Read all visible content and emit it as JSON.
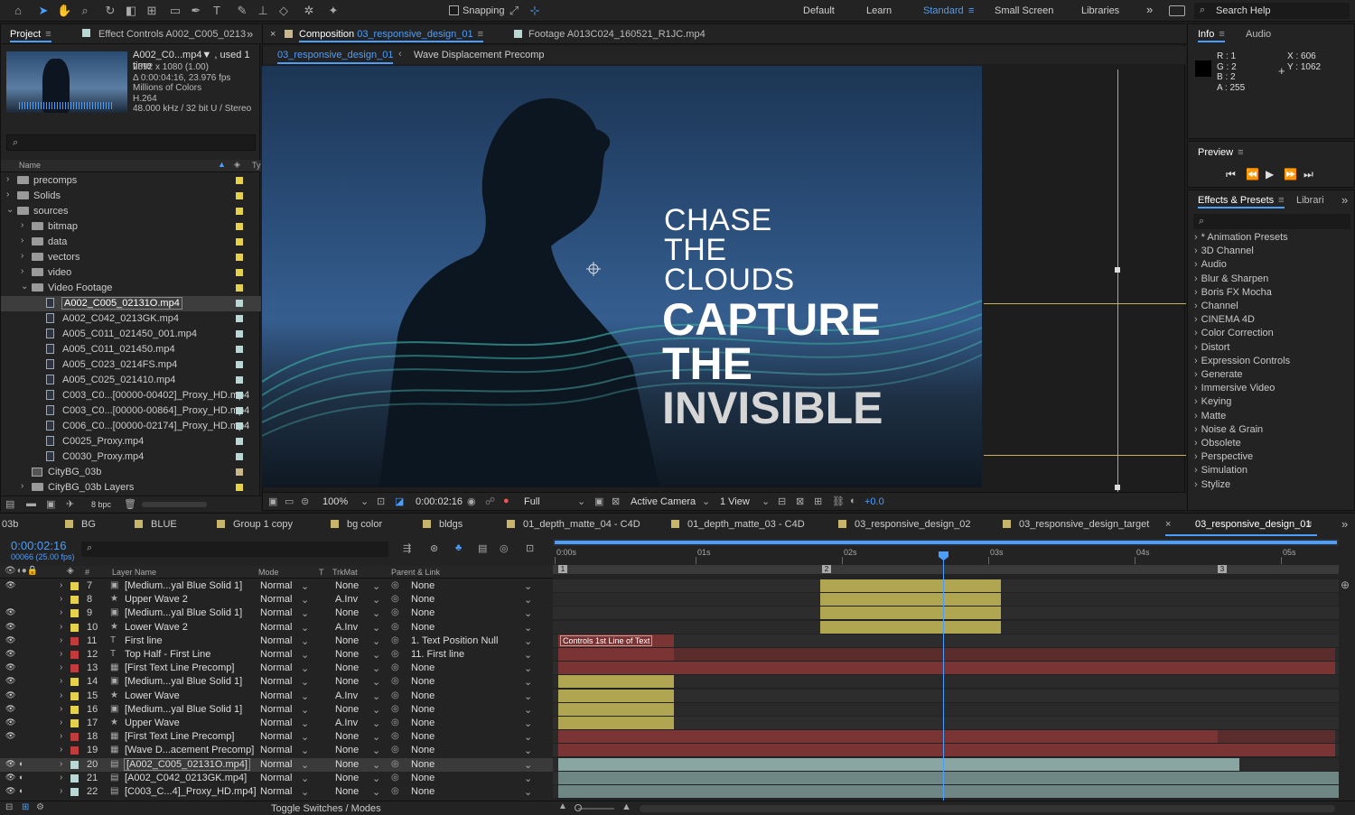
{
  "toolbar": {
    "snapping_label": "Snapping",
    "workspaces": [
      "Default",
      "Learn",
      "Standard",
      "Small Screen",
      "Libraries"
    ],
    "active_workspace": "Standard",
    "search_help": "Search Help"
  },
  "project_panel": {
    "tab_project": "Project",
    "tab_effect_controls": "Effect Controls A002_C005_0213",
    "selected_name": "A002_C0...mp4▼ , used 1 time",
    "info_lines": [
      "2592 x 1080 (1.00)",
      "Δ 0:00:04:16, 23.976 fps",
      "Millions of Colors",
      "H.264",
      "48.000 kHz / 32 bit U / Stereo"
    ],
    "col_name": "Name",
    "col_type": "Ty",
    "bpc": "8 bpc",
    "tree": [
      {
        "label": "precomps",
        "level": 0,
        "kind": "folder",
        "arrow": "›",
        "color": "#e6d24a"
      },
      {
        "label": "Solids",
        "level": 0,
        "kind": "folder",
        "arrow": "›",
        "color": "#e6d24a"
      },
      {
        "label": "sources",
        "level": 0,
        "kind": "folder",
        "arrow": "⌄",
        "color": "#e6d24a"
      },
      {
        "label": "bitmap",
        "level": 1,
        "kind": "folder",
        "arrow": "›",
        "color": "#e6d24a"
      },
      {
        "label": "data",
        "level": 1,
        "kind": "folder",
        "arrow": "›",
        "color": "#e6d24a"
      },
      {
        "label": "vectors",
        "level": 1,
        "kind": "folder",
        "arrow": "›",
        "color": "#e6d24a"
      },
      {
        "label": "video",
        "level": 1,
        "kind": "folder",
        "arrow": "›",
        "color": "#e6d24a"
      },
      {
        "label": "Video Footage",
        "level": 1,
        "kind": "folder",
        "arrow": "⌄",
        "color": "#e6d24a"
      },
      {
        "label": "A002_C005_02131O.mp4",
        "level": 2,
        "kind": "file",
        "arrow": "",
        "color": "#b9d8d5",
        "selected": true
      },
      {
        "label": "A002_C042_0213GK.mp4",
        "level": 2,
        "kind": "file",
        "arrow": "",
        "color": "#b9d8d5"
      },
      {
        "label": "A005_C011_021450_001.mp4",
        "level": 2,
        "kind": "file",
        "arrow": "",
        "color": "#b9d8d5"
      },
      {
        "label": "A005_C011_021450.mp4",
        "level": 2,
        "kind": "file",
        "arrow": "",
        "color": "#b9d8d5"
      },
      {
        "label": "A005_C023_0214FS.mp4",
        "level": 2,
        "kind": "file",
        "arrow": "",
        "color": "#b9d8d5"
      },
      {
        "label": "A005_C025_021410.mp4",
        "level": 2,
        "kind": "file",
        "arrow": "",
        "color": "#b9d8d5"
      },
      {
        "label": "C003_C0...[00000-00402]_Proxy_HD.mp4",
        "level": 2,
        "kind": "file",
        "arrow": "",
        "color": "#b9d8d5"
      },
      {
        "label": "C003_C0...[00000-00864]_Proxy_HD.mp4",
        "level": 2,
        "kind": "file",
        "arrow": "",
        "color": "#b9d8d5"
      },
      {
        "label": "C006_C0...[00000-02174]_Proxy_HD.mp4",
        "level": 2,
        "kind": "file",
        "arrow": "",
        "color": "#b9d8d5"
      },
      {
        "label": "C0025_Proxy.mp4",
        "level": 2,
        "kind": "file",
        "arrow": "",
        "color": "#b9d8d5"
      },
      {
        "label": "C0030_Proxy.mp4",
        "level": 2,
        "kind": "file",
        "arrow": "",
        "color": "#b9d8d5"
      },
      {
        "label": "CityBG_03b",
        "level": 1,
        "kind": "comp",
        "arrow": "",
        "color": "#c8b88a"
      },
      {
        "label": "CityBG_03b Layers",
        "level": 1,
        "kind": "folder",
        "arrow": "›",
        "color": "#e6d24a"
      }
    ]
  },
  "comp_panel": {
    "tab_comp_prefix": "Composition",
    "tab_comp_name": "03_responsive_design_01",
    "tab_footage": "Footage A013C024_160521_R1JC.mp4",
    "breadcrumb_current": "03_responsive_design_01",
    "breadcrumb_next": "Wave Displacement Precomp",
    "overlay_text": {
      "light": [
        "CHASE",
        "THE",
        "CLOUDS"
      ],
      "bold": [
        "CAPTURE",
        "THE",
        "INVISIBLE"
      ]
    },
    "footer": {
      "zoom": "100%",
      "timecode": "0:00:02:16",
      "resolution": "Full",
      "camera": "Active Camera",
      "view": "1 View",
      "exposure": "+0.0"
    }
  },
  "info_panel": {
    "tab_info": "Info",
    "tab_audio": "Audio",
    "r": "R : 1",
    "g": "G : 2",
    "b": "B : 2",
    "a": "A :  255",
    "x": "X : 606",
    "y": "Y : 1062"
  },
  "preview_panel": {
    "tab": "Preview"
  },
  "effects_panel": {
    "tab": "Effects & Presets",
    "tab2": "Librari",
    "items": [
      "* Animation Presets",
      "3D Channel",
      "Audio",
      "Blur & Sharpen",
      "Boris FX Mocha",
      "Channel",
      "CINEMA 4D",
      "Color Correction",
      "Distort",
      "Expression Controls",
      "Generate",
      "Immersive Video",
      "Keying",
      "Matte",
      "Noise & Grain",
      "Obsolete",
      "Perspective",
      "Simulation",
      "Stylize"
    ]
  },
  "timeline": {
    "tabs": [
      "03b",
      "BG",
      "BLUE",
      "Group 1 copy",
      "bg color",
      "bldgs",
      "01_depth_matte_04 - C4D",
      "01_depth_matte_03 - C4D",
      "03_responsive_design_02",
      "03_responsive_design_target",
      "03_responsive_design_01"
    ],
    "timecode": "0:00:02:16",
    "frame_info": "00066 (25.00 fps)",
    "headers": {
      "layer_name": "Layer Name",
      "mode": "Mode",
      "t": "T",
      "trkmat": "TrkMat",
      "parent": "Parent & Link"
    },
    "ruler": [
      "0:00s",
      "01s",
      "02s",
      "03s",
      "04s",
      "05s"
    ],
    "markers": [
      "1",
      "2",
      "3"
    ],
    "bar_label": "Controls 1st Line of Text",
    "toggle_label": "Toggle Switches / Modes",
    "layers": [
      {
        "num": "7",
        "name": "[Medium...yal Blue Solid 1]",
        "mode": "Normal",
        "trk": "None",
        "parent": "None",
        "color": "#e6d24a",
        "icon": "solid"
      },
      {
        "num": "8",
        "name": "Upper Wave 2",
        "mode": "Normal",
        "trk": "A.Inv",
        "parent": "None",
        "color": "#e6d24a",
        "icon": "shape"
      },
      {
        "num": "9",
        "name": "[Medium...yal Blue Solid 1]",
        "mode": "Normal",
        "trk": "None",
        "parent": "None",
        "color": "#e6d24a",
        "icon": "solid"
      },
      {
        "num": "10",
        "name": "Lower Wave 2",
        "mode": "Normal",
        "trk": "A.Inv",
        "parent": "None",
        "color": "#e6d24a",
        "icon": "shape"
      },
      {
        "num": "11",
        "name": "First line",
        "mode": "Normal",
        "trk": "None",
        "parent": "1. Text Position Null",
        "color": "#c23a3a",
        "icon": "text"
      },
      {
        "num": "12",
        "name": "Top Half - First Line",
        "mode": "Normal",
        "trk": "None",
        "parent": "11. First line",
        "color": "#c23a3a",
        "icon": "text"
      },
      {
        "num": "13",
        "name": "[First Text Line Precomp]",
        "mode": "Normal",
        "trk": "None",
        "parent": "None",
        "color": "#c23a3a",
        "icon": "comp"
      },
      {
        "num": "14",
        "name": "[Medium...yal Blue Solid 1]",
        "mode": "Normal",
        "trk": "None",
        "parent": "None",
        "color": "#e6d24a",
        "icon": "solid"
      },
      {
        "num": "15",
        "name": "Lower Wave",
        "mode": "Normal",
        "trk": "A.Inv",
        "parent": "None",
        "color": "#e6d24a",
        "icon": "shape"
      },
      {
        "num": "16",
        "name": "[Medium...yal Blue Solid 1]",
        "mode": "Normal",
        "trk": "None",
        "parent": "None",
        "color": "#e6d24a",
        "icon": "solid"
      },
      {
        "num": "17",
        "name": "Upper Wave",
        "mode": "Normal",
        "trk": "A.Inv",
        "parent": "None",
        "color": "#e6d24a",
        "icon": "shape"
      },
      {
        "num": "18",
        "name": "[First Text Line Precomp]",
        "mode": "Normal",
        "trk": "None",
        "parent": "None",
        "color": "#c23a3a",
        "icon": "comp"
      },
      {
        "num": "19",
        "name": "[Wave D...acement Precomp]",
        "mode": "Normal",
        "trk": "None",
        "parent": "None",
        "color": "#c23a3a",
        "icon": "comp"
      },
      {
        "num": "20",
        "name": "[A002_C005_02131O.mp4]",
        "mode": "Normal",
        "trk": "None",
        "parent": "None",
        "color": "#b9d8d5",
        "icon": "file",
        "selected": true
      },
      {
        "num": "21",
        "name": "[A002_C042_0213GK.mp4]",
        "mode": "Normal",
        "trk": "None",
        "parent": "None",
        "color": "#b9d8d5",
        "icon": "file"
      },
      {
        "num": "22",
        "name": "[C003_C...4]_Proxy_HD.mp4]",
        "mode": "Normal",
        "trk": "None",
        "parent": "None",
        "color": "#b9d8d5",
        "icon": "file"
      }
    ]
  },
  "colors": {
    "accent": "#4a9eff",
    "yellow_bar": "#b0a651",
    "red_bar": "#7a3434",
    "teal_bar": "#8aa6a2",
    "guide": "#c8b060"
  }
}
